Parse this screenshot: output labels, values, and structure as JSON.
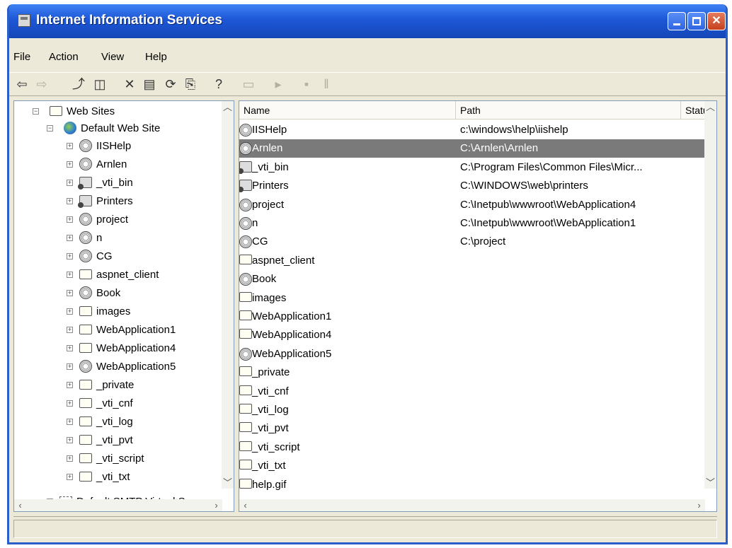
{
  "window": {
    "title": "Internet Information Services",
    "buttons": [
      "minimize",
      "maximize",
      "close"
    ]
  },
  "menu": [
    "File",
    "Action",
    "View",
    "Help"
  ],
  "toolbar": [
    {
      "icon": "back-arrow-icon",
      "enabled": true
    },
    {
      "icon": "forward-arrow-icon",
      "enabled": false
    },
    {
      "icon": "up-one-level-icon",
      "enabled": true
    },
    {
      "icon": "show-hide-tree-icon",
      "enabled": true
    },
    {
      "icon": "delete-icon",
      "enabled": true
    },
    {
      "icon": "properties-icon",
      "enabled": true
    },
    {
      "icon": "refresh-icon",
      "enabled": true
    },
    {
      "icon": "export-list-icon",
      "enabled": true
    },
    {
      "icon": "help-icon",
      "enabled": true
    },
    {
      "icon": "computer-icon",
      "enabled": false
    },
    {
      "icon": "play-icon",
      "enabled": false
    },
    {
      "icon": "stop-icon",
      "enabled": false
    },
    {
      "icon": "pause-icon",
      "enabled": false
    }
  ],
  "tree": {
    "web_sites": "Web Sites",
    "default_web_site": "Default Web Site",
    "children": [
      {
        "label": "IISHelp",
        "icon": "web"
      },
      {
        "label": "Arnlen",
        "icon": "web"
      },
      {
        "label": "_vti_bin",
        "icon": "script-folder"
      },
      {
        "label": "Printers",
        "icon": "script-folder"
      },
      {
        "label": "project",
        "icon": "web"
      },
      {
        "label": "n",
        "icon": "web"
      },
      {
        "label": "CG",
        "icon": "web"
      },
      {
        "label": "aspnet_client",
        "icon": "folder"
      },
      {
        "label": "Book",
        "icon": "web"
      },
      {
        "label": "images",
        "icon": "folder"
      },
      {
        "label": "WebApplication1",
        "icon": "folder"
      },
      {
        "label": "WebApplication4",
        "icon": "folder"
      },
      {
        "label": "WebApplication5",
        "icon": "web"
      },
      {
        "label": "_private",
        "icon": "folder"
      },
      {
        "label": "_vti_cnf",
        "icon": "folder"
      },
      {
        "label": "_vti_log",
        "icon": "folder"
      },
      {
        "label": "_vti_pvt",
        "icon": "folder"
      },
      {
        "label": "_vti_script",
        "icon": "folder"
      },
      {
        "label": "_vti_txt",
        "icon": "folder"
      }
    ],
    "smtp": "Default SMTP Virtual Serv"
  },
  "list": {
    "columns": [
      "Name",
      "Path",
      "Statu"
    ],
    "rows": [
      {
        "name": "IISHelp",
        "path": "c:\\windows\\help\\iishelp",
        "icon": "web",
        "selected": false
      },
      {
        "name": "Arnlen",
        "path": "C:\\Arnlen\\Arnlen",
        "icon": "web",
        "selected": true
      },
      {
        "name": "_vti_bin",
        "path": "C:\\Program Files\\Common Files\\Micr...",
        "icon": "script-folder",
        "selected": false
      },
      {
        "name": "Printers",
        "path": "C:\\WINDOWS\\web\\printers",
        "icon": "script-folder",
        "selected": false
      },
      {
        "name": "project",
        "path": "C:\\Inetpub\\wwwroot\\WebApplication4",
        "icon": "web",
        "selected": false
      },
      {
        "name": "n",
        "path": "C:\\Inetpub\\wwwroot\\WebApplication1",
        "icon": "web",
        "selected": false
      },
      {
        "name": "CG",
        "path": "C:\\project",
        "icon": "web",
        "selected": false
      },
      {
        "name": "aspnet_client",
        "path": "",
        "icon": "folder",
        "selected": false
      },
      {
        "name": "Book",
        "path": "",
        "icon": "web",
        "selected": false
      },
      {
        "name": "images",
        "path": "",
        "icon": "folder",
        "selected": false
      },
      {
        "name": "WebApplication1",
        "path": "",
        "icon": "folder",
        "selected": false
      },
      {
        "name": "WebApplication4",
        "path": "",
        "icon": "folder",
        "selected": false
      },
      {
        "name": "WebApplication5",
        "path": "",
        "icon": "web",
        "selected": false
      },
      {
        "name": "_private",
        "path": "",
        "icon": "folder",
        "selected": false
      },
      {
        "name": "_vti_cnf",
        "path": "",
        "icon": "folder",
        "selected": false
      },
      {
        "name": "_vti_log",
        "path": "",
        "icon": "folder",
        "selected": false
      },
      {
        "name": "_vti_pvt",
        "path": "",
        "icon": "folder",
        "selected": false
      },
      {
        "name": "_vti_script",
        "path": "",
        "icon": "folder",
        "selected": false
      },
      {
        "name": "_vti_txt",
        "path": "",
        "icon": "folder",
        "selected": false
      },
      {
        "name": "help.gif",
        "path": "",
        "icon": "file",
        "selected": false
      }
    ]
  },
  "colors": {
    "titlebar": "#1d57d6",
    "selection": "#7a7a7a",
    "face": "#ece9d8"
  }
}
